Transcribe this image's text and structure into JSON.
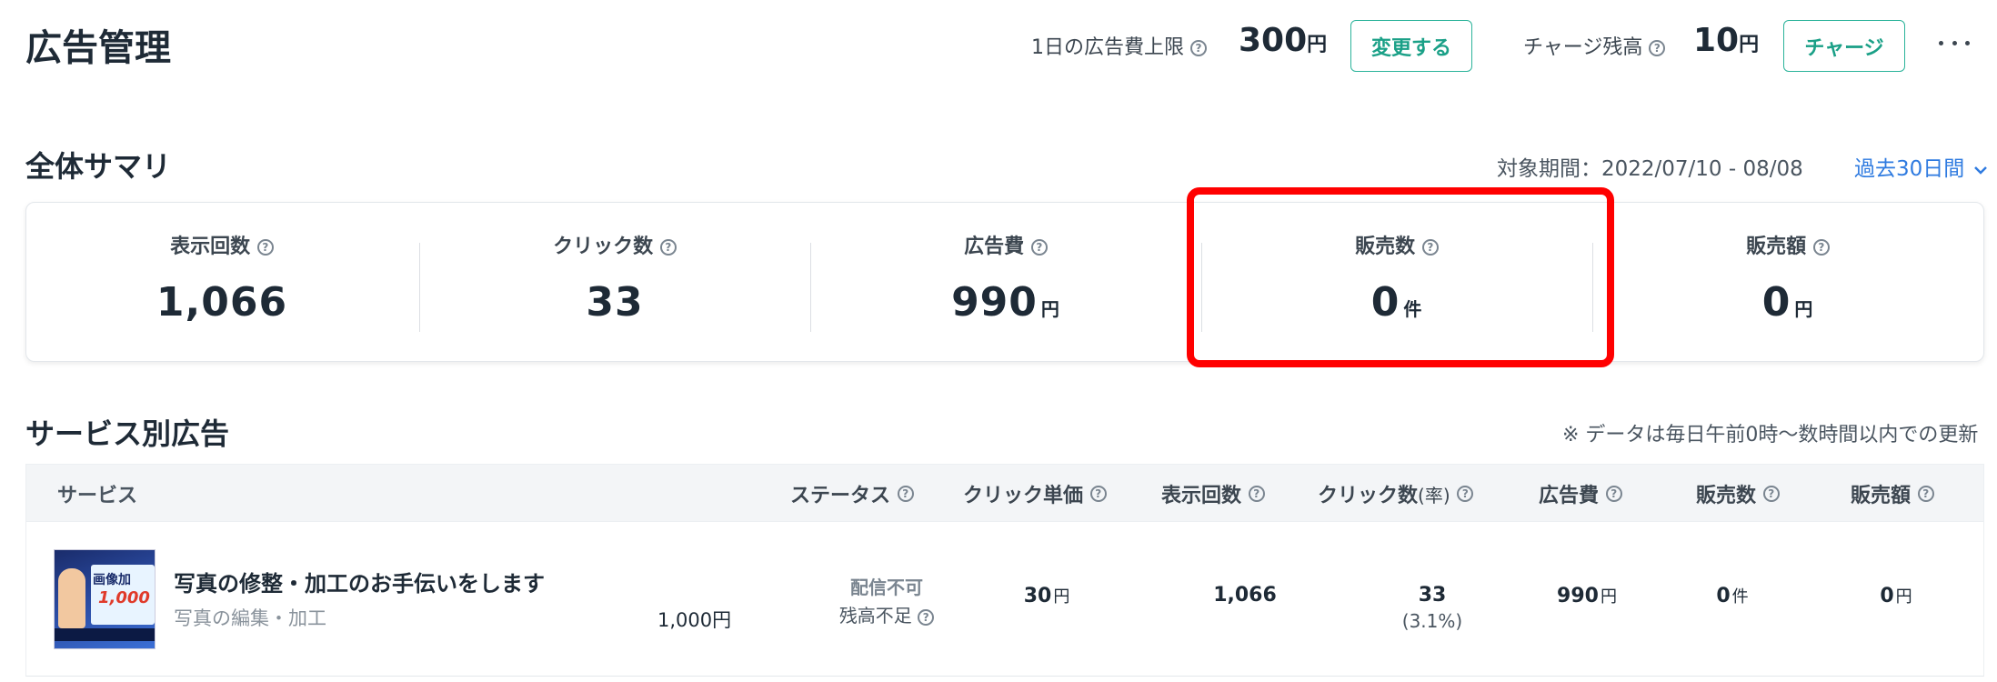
{
  "header": {
    "title": "広告管理",
    "daily_limit_label": "1日の広告費上限",
    "daily_limit_value": "300",
    "daily_limit_unit": "円",
    "change_button": "変更する",
    "balance_label": "チャージ残高",
    "balance_value": "10",
    "balance_unit": "円",
    "charge_button": "チャージ",
    "more_icon": "…"
  },
  "summary": {
    "title": "全体サマリ",
    "period_label": "対象期間：2022/07/10 - 08/08",
    "period_select": "過去30日間",
    "metrics": [
      {
        "label": "表示回数",
        "value": "1,066",
        "unit": ""
      },
      {
        "label": "クリック数",
        "value": "33",
        "unit": ""
      },
      {
        "label": "広告費",
        "value": "990",
        "unit": "円"
      },
      {
        "label": "販売数",
        "value": "0",
        "unit": "件"
      },
      {
        "label": "販売額",
        "value": "0",
        "unit": "円"
      }
    ],
    "highlight_color": "#ff0000"
  },
  "services": {
    "title": "サービス別広告",
    "note": "※ データは毎日午前0時～数時間以内での更新",
    "columns": {
      "service": "サービス",
      "status": "ステータス",
      "cpc": "クリック単価",
      "impressions": "表示回数",
      "clicks": "クリック数",
      "clicks_rate": "(率)",
      "cost": "広告費",
      "sales_count": "販売数",
      "sales_amount": "販売額"
    },
    "rows": [
      {
        "thumb_line1": "画像加",
        "thumb_line2": "1,000",
        "name": "写真の修整・加工のお手伝いをします",
        "category": "写真の編集・加工",
        "price": "1,000円",
        "status": "配信不可",
        "status_reason": "残高不足",
        "cpc": "30",
        "cpc_unit": "円",
        "impressions": "1,066",
        "clicks": "33",
        "click_rate": "(3.1%)",
        "cost": "990",
        "cost_unit": "円",
        "sales_count": "0",
        "sales_count_unit": "件",
        "sales_amount": "0",
        "sales_amount_unit": "円"
      }
    ]
  },
  "colors": {
    "accent": "#2bb39a",
    "link": "#2f7be0",
    "highlight": "#ff0000"
  }
}
